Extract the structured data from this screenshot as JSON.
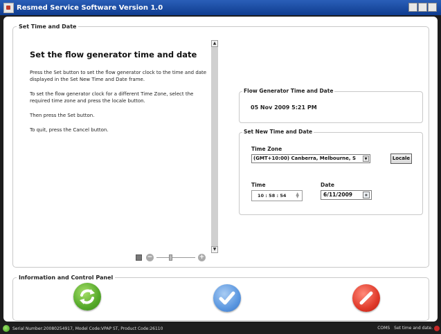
{
  "window": {
    "title": "Resmed Service Software Version 1.0"
  },
  "set_time_panel": {
    "legend": "Set Time and Date",
    "heading": "Set the flow generator time and date",
    "instructions": [
      "Press the Set button to set the flow generator clock to the time and date displayed in the Set New Time and Date frame.",
      "To set the flow generator clock for a different Time Zone, select the required time zone and press the locale button.",
      "Then press the Set button.",
      "To quit, press the Cancel button."
    ]
  },
  "flow_generator": {
    "legend": "Flow Generator Time and Date",
    "datetime": "05 Nov 2009 5:21 PM"
  },
  "new_time": {
    "legend": "Set New Time and Date",
    "time_zone_label": "Time Zone",
    "time_zone_value": "(GMT+10:00) Canberra, Melbourne, S",
    "locale_label": "Locale",
    "time_label": "Time",
    "time_value": "10 : 58 : 54",
    "date_label": "Date",
    "date_value": "6/11/2009"
  },
  "info_panel": {
    "legend": "Information and Control Panel"
  },
  "status": {
    "left": "Serial Number:20080254917, Model Code:VPAP ST, Product Code:26110",
    "coms": "COMS",
    "message": "Set time and date."
  },
  "colors": {
    "title_bar": "#1a4ca3",
    "refresh": "#55a92a",
    "confirm": "#5b97e0",
    "cancel": "#e03a2a"
  }
}
